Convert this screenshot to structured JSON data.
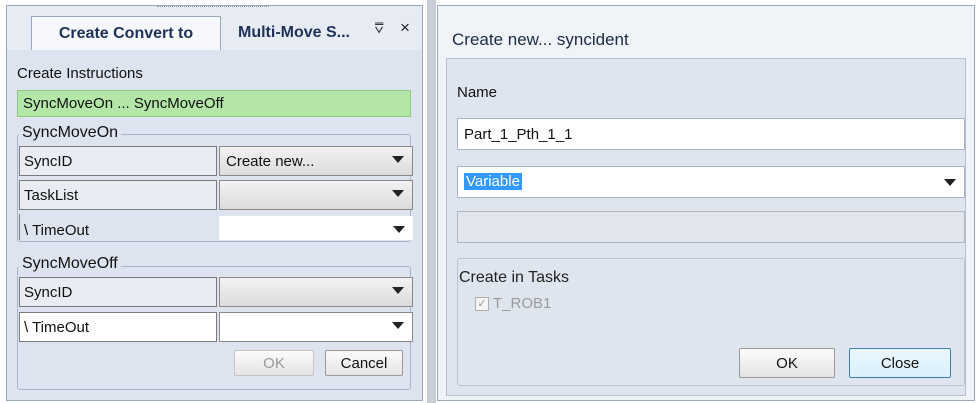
{
  "left_panel": {
    "tabs": [
      {
        "label": "Create Convert to"
      },
      {
        "label": "Multi-Move S..."
      }
    ],
    "tab_dropdown_glyph": "⩢",
    "close_glyph": "×",
    "create_instructions_label": "Create Instructions",
    "instruction_item": "SyncMoveOn ... SyncMoveOff",
    "sync_on": {
      "title": "SyncMoveOn",
      "rows": [
        {
          "label": "SyncID",
          "value": "Create new..."
        },
        {
          "label": "TaskList",
          "value": ""
        },
        {
          "label": "\\ TimeOut",
          "value": ""
        }
      ]
    },
    "sync_off": {
      "title": "SyncMoveOff",
      "rows": [
        {
          "label": "SyncID",
          "value": ""
        },
        {
          "label": "\\ TimeOut",
          "value": ""
        }
      ]
    },
    "ok_label": "OK",
    "cancel_label": "Cancel"
  },
  "right_panel": {
    "title": "Create new... syncident",
    "name_label": "Name",
    "name_value": "Part_1_Pth_1_1",
    "type_value": "Variable",
    "tasks_title": "Create in Tasks",
    "task_label": "T_ROB1",
    "task_checked": true,
    "ok_label": "OK",
    "close_label": "Close"
  },
  "colors": {
    "panel_bg": "#dde4ef",
    "instruction_bg": "#b4e6a8",
    "selection_bg": "#3399ff",
    "title_text": "#1e3158"
  },
  "icons": [
    "dropdown-icon",
    "close-icon",
    "chevron-down-icon",
    "checkbox-icon"
  ]
}
